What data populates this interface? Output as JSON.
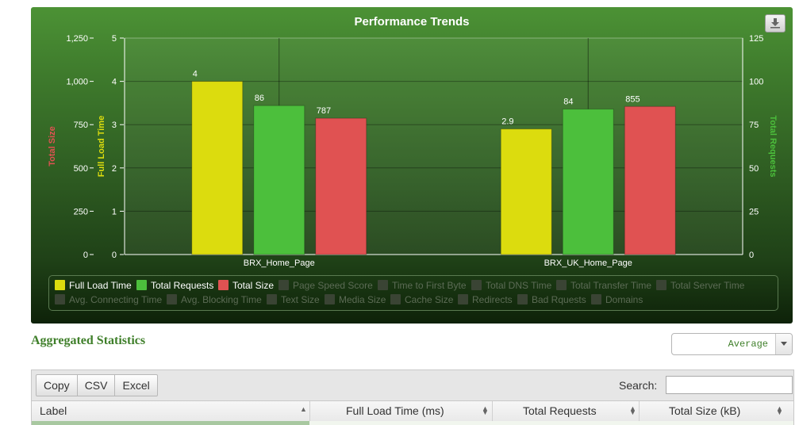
{
  "chart": {
    "title": "Performance Trends",
    "download_icon": "download-icon"
  },
  "chart_data": {
    "type": "bar",
    "title": "Performance Trends",
    "categories": [
      "BRX_Home_Page",
      "BRX_UK_Home_Page"
    ],
    "series": [
      {
        "name": "Full Load Time",
        "axis": "Full Load Time",
        "color": "#dcdc0e",
        "values": [
          4,
          2.9
        ],
        "labels": [
          "4",
          "2.9"
        ]
      },
      {
        "name": "Total Requests",
        "axis": "Total Requests",
        "color": "#4cbf3c",
        "values": [
          86,
          84
        ],
        "labels": [
          "86",
          "84"
        ]
      },
      {
        "name": "Total Size",
        "axis": "Total Size",
        "color": "#e05252",
        "values": [
          787,
          855
        ],
        "labels": [
          "787",
          "855"
        ]
      }
    ],
    "axes": {
      "size": {
        "title": "Total Size",
        "color": "#e05252",
        "ylim": [
          0,
          1250
        ],
        "ticks": [
          "1,250",
          "1,000",
          "750",
          "500",
          "250",
          "0"
        ]
      },
      "time": {
        "title": "Full Load Time",
        "color": "#dcdc0e",
        "ylim": [
          0,
          5
        ],
        "ticks": [
          "5",
          "4",
          "3",
          "2",
          "1",
          "0"
        ]
      },
      "requests": {
        "title": "Total Requests",
        "color": "#4cbf3c",
        "ylim": [
          0,
          125
        ],
        "ticks": [
          "125",
          "100",
          "75",
          "50",
          "25",
          "0"
        ]
      }
    },
    "grid": true,
    "legend_position": "bottom"
  },
  "legend": {
    "items": [
      {
        "label": "Full Load Time",
        "color": "#dcdc0e",
        "active": true
      },
      {
        "label": "Total Requests",
        "color": "#4cbf3c",
        "active": true
      },
      {
        "label": "Total Size",
        "color": "#e05252",
        "active": true
      },
      {
        "label": "Page Speed Score",
        "active": false
      },
      {
        "label": "Time to First Byte",
        "active": false
      },
      {
        "label": "Total DNS Time",
        "active": false
      },
      {
        "label": "Total Transfer Time",
        "active": false
      },
      {
        "label": "Total Server Time",
        "active": false
      },
      {
        "label": "Avg. Connecting Time",
        "active": false
      },
      {
        "label": "Avg. Blocking Time",
        "active": false
      },
      {
        "label": "Text Size",
        "active": false
      },
      {
        "label": "Media Size",
        "active": false
      },
      {
        "label": "Cache Size",
        "active": false
      },
      {
        "label": "Redirects",
        "active": false
      },
      {
        "label": "Bad Rquests",
        "active": false
      },
      {
        "label": "Domains",
        "active": false
      }
    ]
  },
  "aggregated": {
    "title": "Aggregated Statistics",
    "select_value": "Average"
  },
  "table": {
    "buttons": [
      "Copy",
      "CSV",
      "Excel"
    ],
    "search_label": "Search:",
    "search_value": "",
    "columns": [
      "Label",
      "Full Load Time (ms)",
      "Total Requests",
      "Total Size (kB)"
    ]
  },
  "colors": {
    "accent_green": "#3f7f2a",
    "panel_green": "#3e7a2c"
  }
}
